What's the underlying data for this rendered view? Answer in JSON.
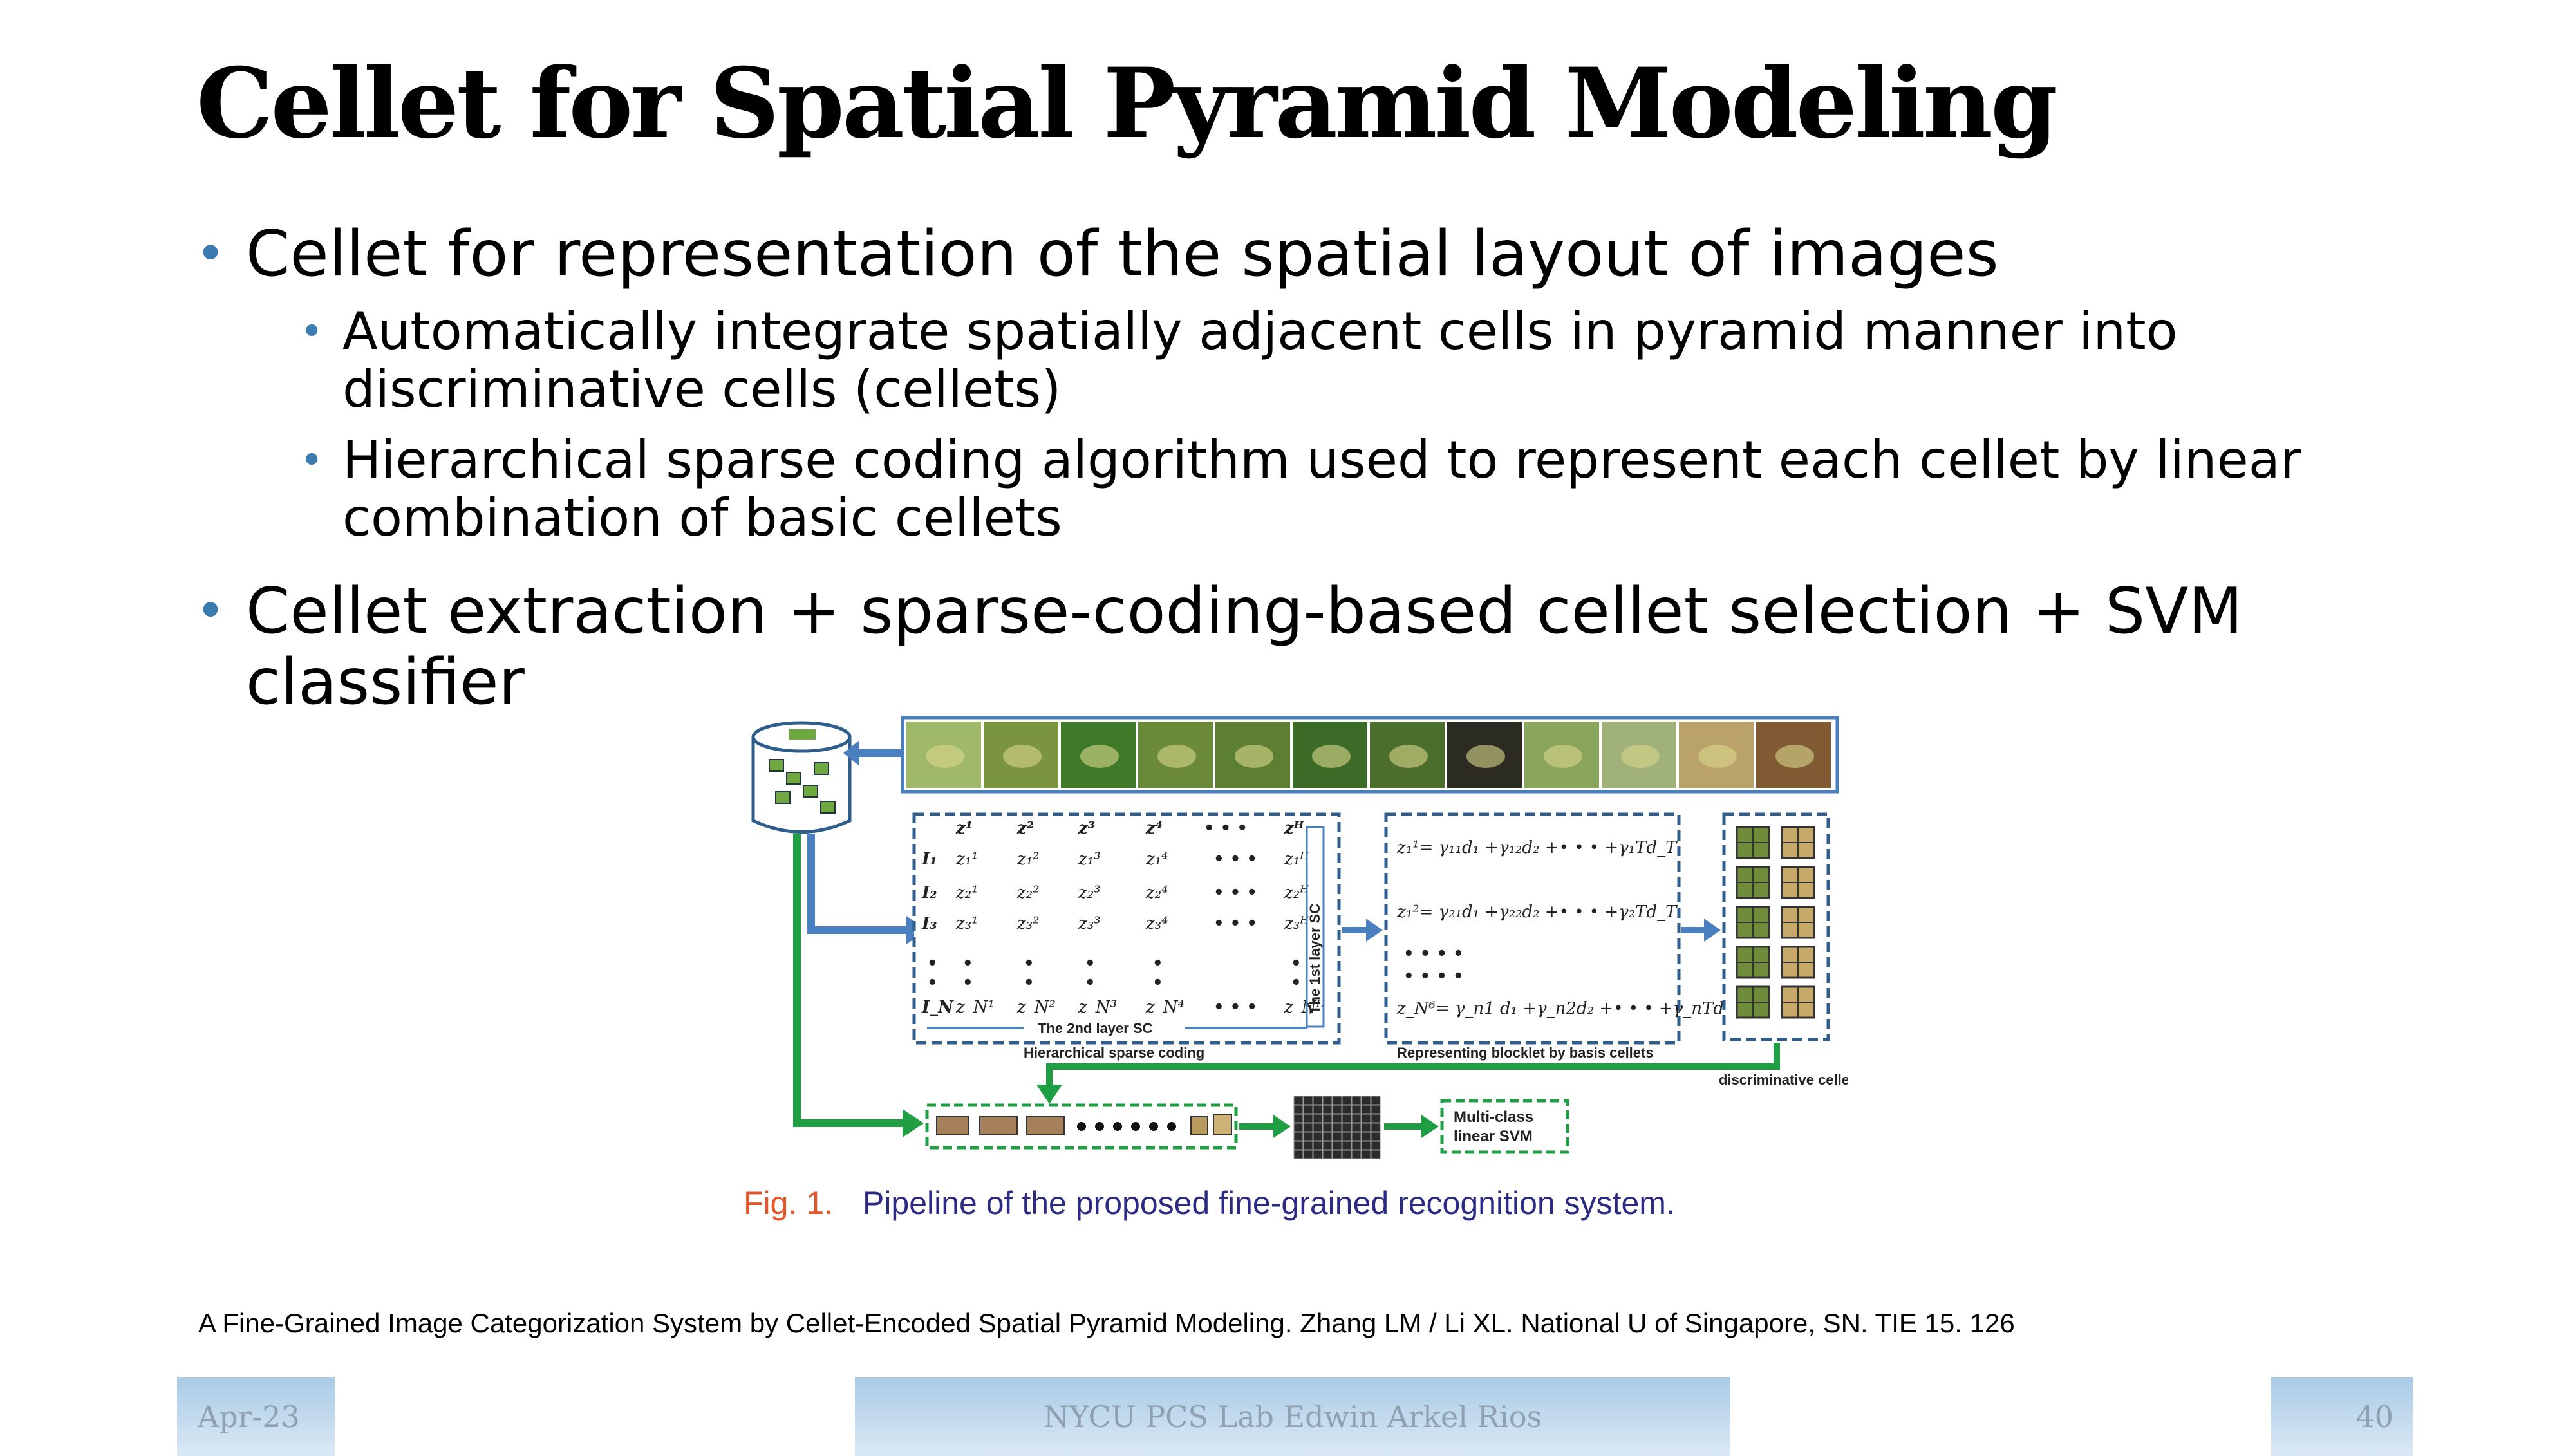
{
  "slide": {
    "title": "Cellet for Spatial Pyramid Modeling",
    "bullets": [
      {
        "text": "Cellet for representation of the spatial layout of images",
        "sub": [
          {
            "line1": "Automatically integrate spatially adjacent cells in pyramid manner into",
            "line2": "discriminative cells (cellets)"
          },
          {
            "line1": "Hierarchical sparse coding algorithm used to represent each cellet by linear",
            "line2": "combination of basic cellets"
          }
        ]
      },
      {
        "line1": "Cellet extraction + sparse-coding-based cellet selection + SVM",
        "line2": "classifier"
      }
    ],
    "bullet_glyph": "•"
  },
  "figure": {
    "caption_number": "Fig. 1.",
    "caption_text": "Pipeline of the proposed fine-grained recognition system.",
    "image_rows": [
      "I",
      "I",
      "I",
      "I"
    ],
    "layer2_label": "The 2nd layer SC",
    "layer1_label": "The 1st layer SC",
    "panel1_title": "Hierarchical sparse coding",
    "panel2_title": "Representing blocklet by basis cellets",
    "discriminative_label": "discriminative cellets",
    "svm_label": "Multi-class linear SVM",
    "leaf_thumbnail_colors": [
      "#9fb86a",
      "#7a9440",
      "#3f7a2a",
      "#6a8a3a",
      "#5c7f33",
      "#3c6b28",
      "#4b6e2c",
      "#2b2b22",
      "#8aa65c",
      "#a0b27a",
      "#b9a36a",
      "#7f5a32"
    ]
  },
  "reference": "A Fine-Grained Image Categorization System by Cellet-Encoded Spatial Pyramid Modeling. Zhang LM / Li XL. National U of Singapore, SN. TIE 15. 126",
  "footer": {
    "date": "Apr-23",
    "center": "NYCU PCS Lab Edwin Arkel Rios",
    "page": "40"
  },
  "colors": {
    "bullet": "#3b7bb0",
    "arrow_blue": "#4a7fc0",
    "arrow_green": "#1f9e44",
    "dashed_box": "#2f5d8c",
    "caption_number": "#e4562a",
    "caption_text": "#2c2b84"
  }
}
